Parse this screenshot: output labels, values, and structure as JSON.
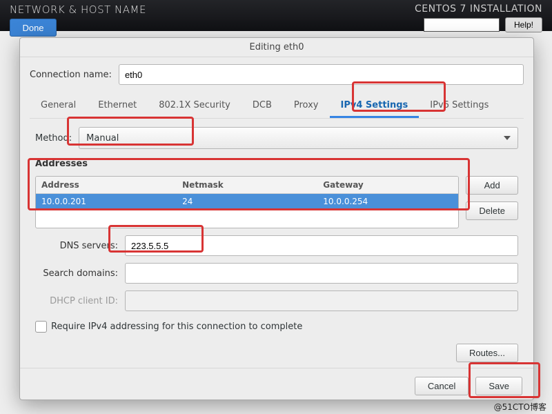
{
  "header": {
    "title": "NETWORK & HOST NAME",
    "done": "Done",
    "install_title": "CENTOS 7 INSTALLATION",
    "help": "Help!"
  },
  "dialog": {
    "title": "Editing eth0",
    "connection_label": "Connection name:",
    "connection_value": "eth0",
    "tabs": [
      "General",
      "Ethernet",
      "802.1X Security",
      "DCB",
      "Proxy",
      "IPv4 Settings",
      "IPv6 Settings"
    ],
    "active_tab": "IPv4 Settings",
    "method_label": "Method:",
    "method_value": "Manual",
    "addresses_label": "Addresses",
    "addr_headers": {
      "address": "Address",
      "netmask": "Netmask",
      "gateway": "Gateway"
    },
    "addr_row": {
      "address": "10.0.0.201",
      "netmask": "24",
      "gateway": "10.0.0.254"
    },
    "add": "Add",
    "delete": "Delete",
    "dns_label": "DNS servers:",
    "dns_value": "223.5.5.5",
    "search_label": "Search domains:",
    "search_value": "",
    "dhcp_label": "DHCP client ID:",
    "dhcp_value": "",
    "require_label": "Require IPv4 addressing for this connection to complete",
    "routes": "Routes...",
    "cancel": "Cancel",
    "save": "Save"
  },
  "watermark": "@51CTO博客"
}
